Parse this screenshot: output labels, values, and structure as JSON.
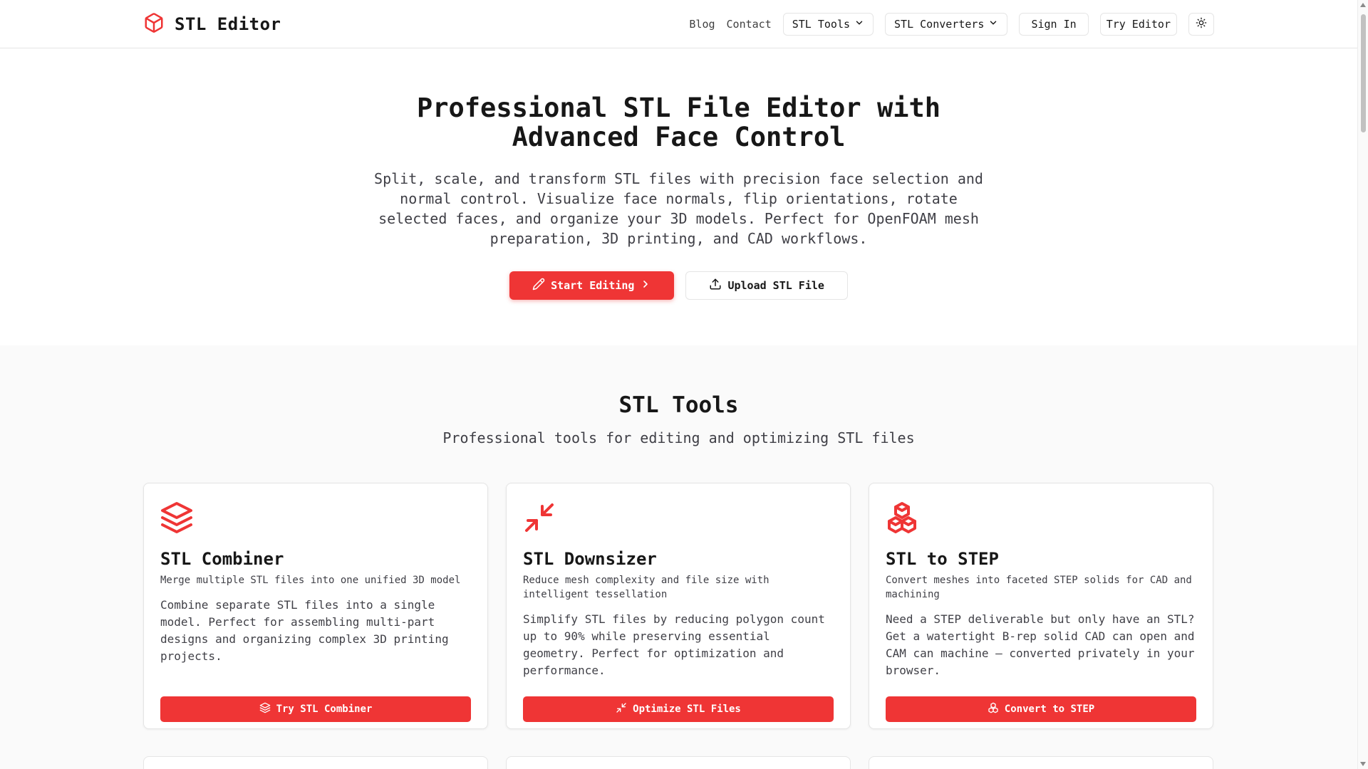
{
  "colors": {
    "accent": "#ef3535",
    "text": "#171717",
    "muted": "#3f3f46",
    "border": "#e5e5e5",
    "section_bg": "#fafafa"
  },
  "header": {
    "logo_icon": "cube-icon",
    "brand": "STL Editor",
    "nav": {
      "blog": "Blog",
      "contact": "Contact",
      "stl_tools": "STL Tools",
      "stl_converters": "STL Converters",
      "sign_in": "Sign In",
      "try_editor": "Try Editor",
      "theme_icon": "sun-icon"
    }
  },
  "hero": {
    "title_line1": "Professional STL File Editor with",
    "title_line2": "Advanced Face Control",
    "subtitle": "Split, scale, and transform STL files with precision face selection and normal control. Visualize face normals, flip orientations, rotate selected faces, and organize your 3D models. Perfect for OpenFOAM mesh preparation, 3D printing, and CAD workflows.",
    "primary_button": "Start Editing",
    "primary_icon": "pencil-icon",
    "secondary_button": "Upload STL File",
    "secondary_icon": "upload-icon"
  },
  "tools": {
    "title": "STL Tools",
    "subtitle": "Professional tools for editing and optimizing STL files",
    "cards": [
      {
        "icon": "layers-icon",
        "title": "STL Combiner",
        "tagline": "Merge multiple STL files into one unified 3D model",
        "description": "Combine separate STL files into a single model. Perfect for assembling multi-part designs and organizing complex 3D printing projects.",
        "button": "Try STL Combiner"
      },
      {
        "icon": "shrink-icon",
        "title": "STL Downsizer",
        "tagline": "Reduce mesh complexity and file size with intelligent tessellation",
        "description": "Simplify STL files by reducing polygon count up to 90% while preserving essential geometry. Perfect for optimization and performance.",
        "button": "Optimize STL Files"
      },
      {
        "icon": "boxes-icon",
        "title": "STL to STEP",
        "tagline": "Convert meshes into faceted STEP solids for CAD and machining",
        "description": "Need a STEP deliverable but only have an STL? Get a watertight B-rep solid CAD can open and CAM can machine — converted privately in your browser.",
        "button": "Convert to STEP"
      }
    ]
  }
}
